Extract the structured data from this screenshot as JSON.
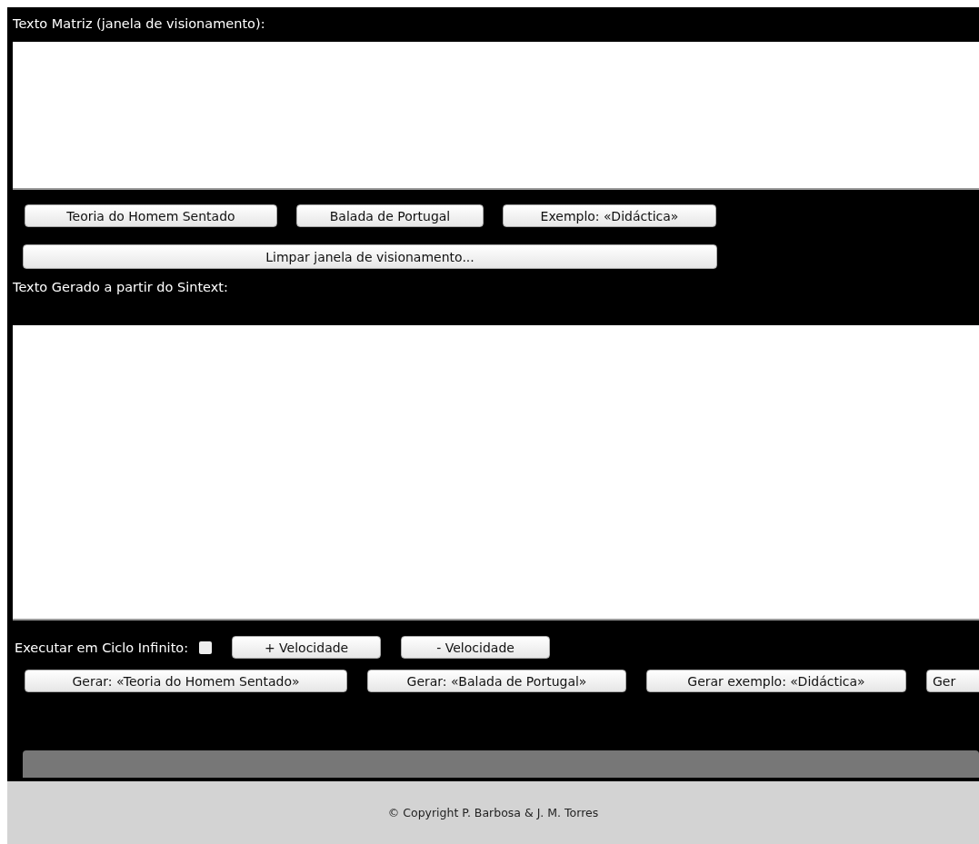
{
  "matrix": {
    "label": "Texto Matriz (janela de visionamento):"
  },
  "text_buttons": [
    "Teoria do Homem Sentado",
    "Balada de Portugal",
    "Exemplo: «Didáctica»"
  ],
  "clear_button": "Limpar janela de visionamento...",
  "generated": {
    "label": "Texto Gerado a partir do Sintext:"
  },
  "loop": {
    "label": "Executar em Ciclo Infinito:",
    "checked": false
  },
  "speed_buttons": [
    "+ Velocidade",
    "- Velocidade"
  ],
  "generate_buttons": [
    "Gerar: «Teoria do Homem Sentado»",
    "Gerar: «Balada de Portugal»",
    "Gerar exemplo: «Didáctica»",
    "Ger"
  ],
  "footer": "© Copyright P. Barbosa & J. M. Torres"
}
